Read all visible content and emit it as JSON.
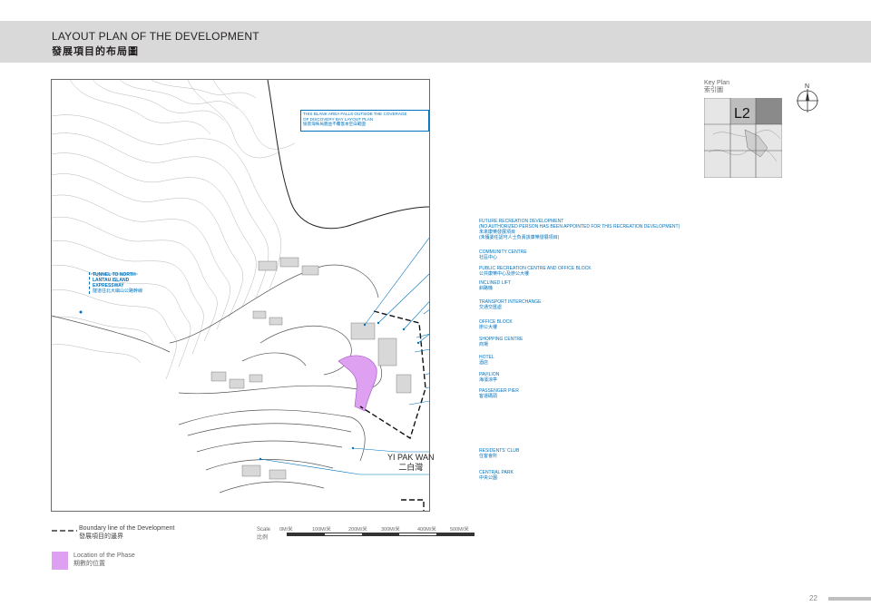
{
  "header": {
    "title_en": "LAYOUT PLAN OF THE DEVELOPMENT",
    "title_zh": "發展項目的布局圖"
  },
  "map": {
    "blank_area_note": {
      "line1": "THIS BLANK AREA FALLS OUTSIDE THE COVERAGE",
      "line2": "OF DISCOVERY BAY LAYOUT PLAN",
      "line3": "愉景灣佈局圖並不覆蓋本空白範圍"
    },
    "tunnel": {
      "line1": "TUNNEL TO NORTH",
      "line2": "LANTAU ISLAND",
      "line3": "EXPRESSWAY",
      "zh": "隧道往北大嶼山公路幹線"
    },
    "place_name": {
      "en": "YI PAK WAN",
      "zh": "二白灣"
    },
    "labels": [
      {
        "en": "FUTURE RECREATION DEVELOPMENT",
        "en2": "(NO AUTHORIZED PERSON HAS BEEN APPOINTED FOR THIS RECREATION DEVELOPMENT)",
        "zh": "未來康樂發展項目",
        "zh2": "(未獲委任認可人士負責該康樂發展項目)"
      },
      {
        "en": "COMMUNITY CENTRE",
        "zh": "社區中心"
      },
      {
        "en": "PUBLIC RECREATION CENTRE AND OFFICE BLOCK",
        "zh": "公共康樂中心及辦公大樓"
      },
      {
        "en": "INCLINED LIFT",
        "zh": "斜路機"
      },
      {
        "en": "TRANSPORT INTERCHANGE",
        "zh": "交通交匯處"
      },
      {
        "en": "OFFICE BLOCK",
        "zh": "辦公大樓"
      },
      {
        "en": "SHOPPING CENTRE",
        "zh": "商場"
      },
      {
        "en": "HOTEL",
        "zh": "酒店"
      },
      {
        "en": "PAVILION",
        "zh": "海濱涼亭"
      },
      {
        "en": "PASSENGER PIER",
        "zh": "客運碼頭"
      },
      {
        "en": "RESIDENTS' CLUB",
        "zh": "住客會所"
      },
      {
        "en": "CENTRAL PARK",
        "zh": "中央公園"
      }
    ]
  },
  "key_plan": {
    "label_en": "Key Plan",
    "label_zh": "索引圖",
    "tile": "L2"
  },
  "north_label": "N",
  "legend": {
    "boundary_en": "Boundary line of the Development",
    "boundary_zh": "發展項目的邊界",
    "phase_en": "Location of the Phase",
    "phase_zh": "期數的位置",
    "phase_color": "#dea0f0"
  },
  "scale": {
    "label_en": "Scale",
    "label_zh": "比例",
    "ticks": [
      "0M/米",
      "100M/米",
      "200M/米",
      "300M/米",
      "400M/米",
      "500M/米"
    ]
  },
  "page": {
    "number": "22"
  },
  "colors": {
    "accent_blue": "#0072bc",
    "header_band": "#d9d9d9"
  }
}
